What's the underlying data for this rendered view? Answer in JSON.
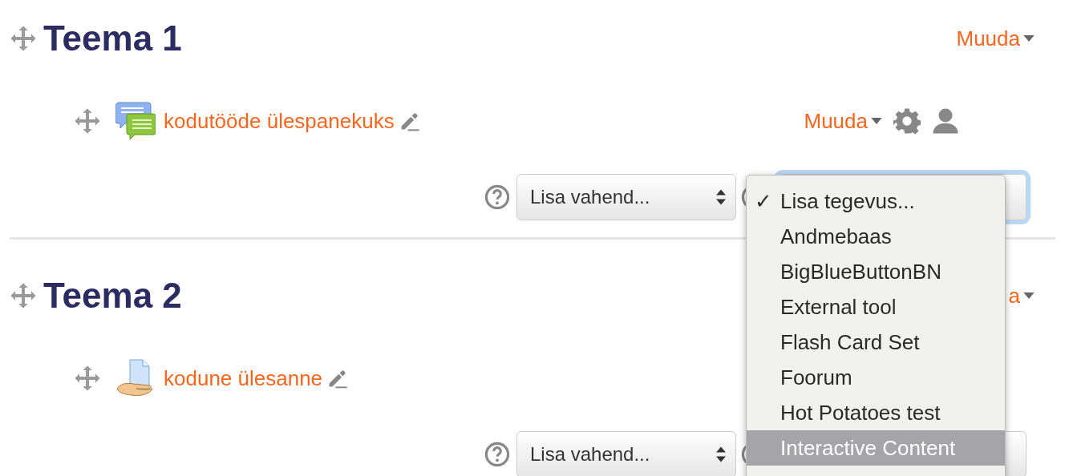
{
  "sections": [
    {
      "title": "Teema 1",
      "edit_label": "Muuda",
      "activity": {
        "kind": "forum",
        "name": "kodutööde ülespanekuks",
        "edit_label": "Muuda"
      },
      "add_resource": "Lisa vahend...",
      "add_activity_focused": true
    },
    {
      "title": "Teema 2",
      "edit_label": "a",
      "activity": {
        "kind": "assignment",
        "name": "kodune ülesanne"
      },
      "add_resource": "Lisa vahend..."
    }
  ],
  "dropdown": {
    "items": [
      {
        "label": "Lisa tegevus...",
        "check_mark": "✓",
        "selected": false
      },
      {
        "label": "Andmebaas",
        "selected": false
      },
      {
        "label": "BigBlueButtonBN",
        "selected": false
      },
      {
        "label": "External tool",
        "selected": false
      },
      {
        "label": "Flash Card Set",
        "selected": false
      },
      {
        "label": "Foorum",
        "selected": false
      },
      {
        "label": "Hot Potatoes test",
        "selected": false
      },
      {
        "label": "Interactive Content",
        "selected": true
      }
    ]
  }
}
